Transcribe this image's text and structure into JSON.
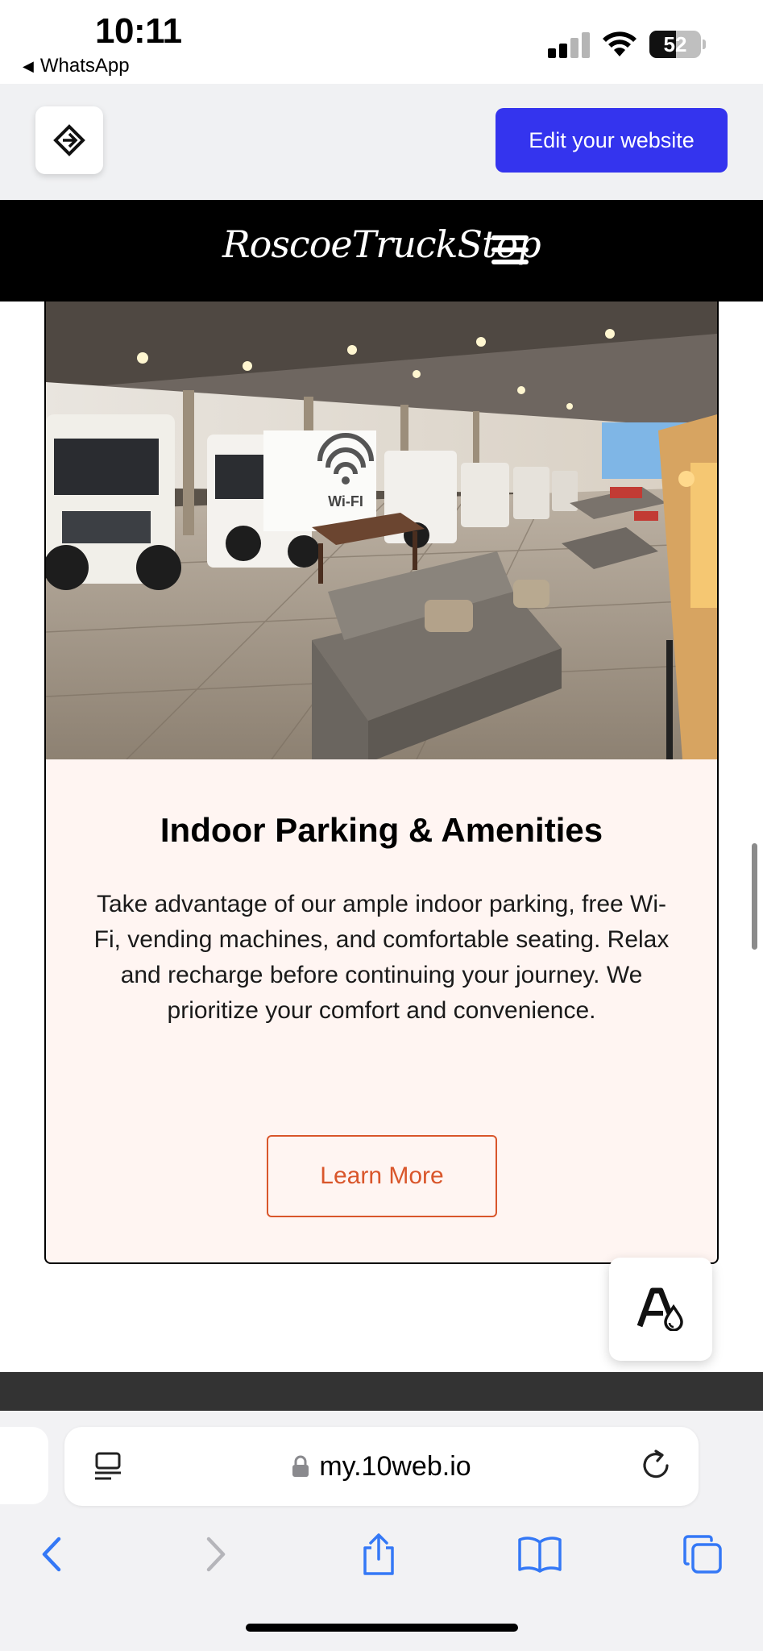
{
  "status_bar": {
    "time": "10:11",
    "back_app": "WhatsApp",
    "battery": "52",
    "battery_level": 0.52
  },
  "editor_bar": {
    "edit_label": "Edit your website",
    "accent": "#3434ee"
  },
  "site_header": {
    "brand": "RoscoeTruckStop"
  },
  "card": {
    "image_sign": "Wi-FI",
    "title": "Indoor Parking & Amenities",
    "text": "Take advantage of our ample indoor parking, free Wi-Fi, vending machines, and comfortable seating. Relax and recharge before continuing your journey. We prioritize your comfort and convenience.",
    "button_label": "Learn More",
    "button_color": "#d9562b",
    "background": "#fff5f2"
  },
  "safari": {
    "url": "my.10web.io",
    "icons": [
      "back-icon",
      "forward-icon",
      "share-icon",
      "bookmarks-icon",
      "tabs-icon"
    ]
  }
}
